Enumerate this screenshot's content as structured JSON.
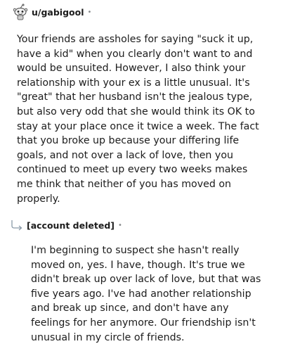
{
  "comment": {
    "avatar_icon": "snoo-avatar-icon",
    "username": "u/gabigool",
    "separator": "•",
    "body": "Your friends are assholes for saying \"suck it up, have a kid\" when you clearly don't want to and would be unsuited. However, I also think your relationship with your ex is a little unusual. It's \"great\" that her husband isn't the jealous type, but also very odd that she would think its OK to stay at your place once it twice a week. The fact that you broke up because your differing life goals, and not over a lack of love, then you continued to meet up every two weeks makes me think that neither of you has moved on properly."
  },
  "reply": {
    "reply_icon": "reply-arrow-icon",
    "username": "[account deleted]",
    "separator": "•",
    "body": "I'm beginning to suspect she hasn't really moved on, yes. I have, though. It's true we didn't break up over lack of love, but that was five years ago. I've had another relationship and break up since, and don't have any feelings for her anymore. Our friendship isn't unusual in my circle of friends."
  }
}
